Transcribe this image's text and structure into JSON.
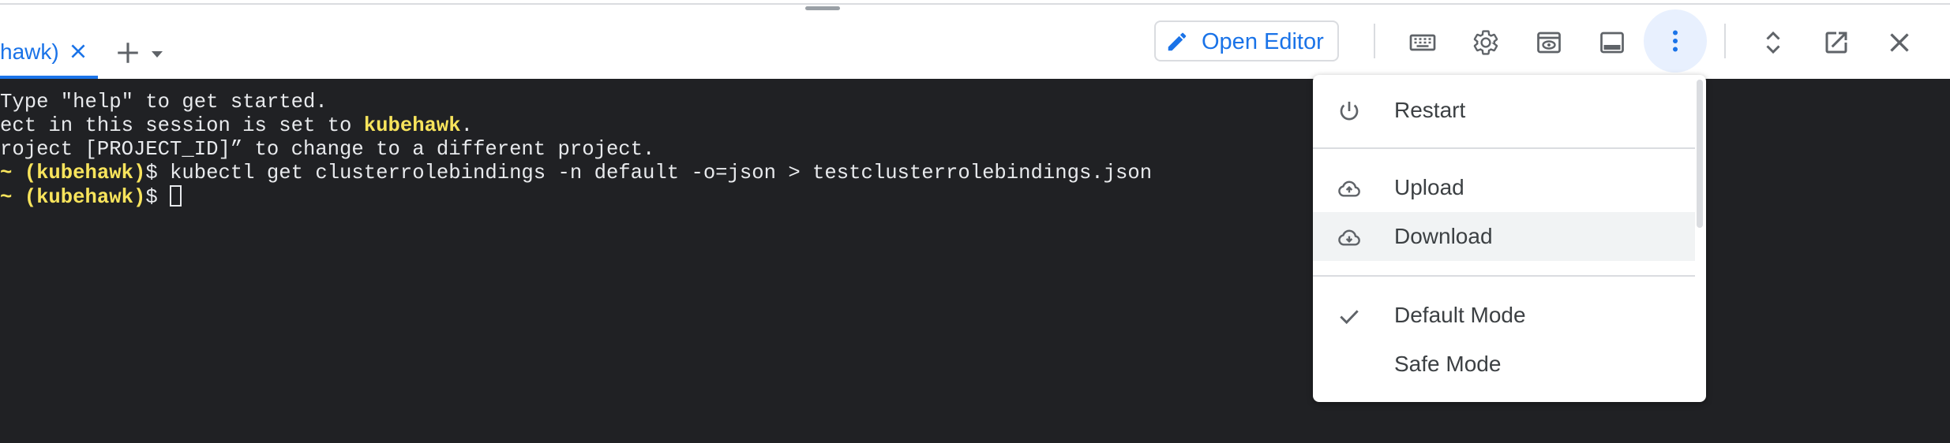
{
  "tab": {
    "label": "hawk)"
  },
  "toolbar": {
    "open_editor_label": "Open Editor"
  },
  "terminal": {
    "line1": "Type \"help\" to get started.",
    "line2_prefix": "ect in this session is set to ",
    "line2_project": "kubehawk",
    "line2_suffix": ".",
    "line3": "roject [PROJECT_ID]” to change to a different project.",
    "prompt_tilde": "~ ",
    "prompt_project": "(kubehawk)",
    "prompt_dollar": "$ ",
    "command1": "kubectl get clusterrolebindings -n default -o=json > testclusterrolebindings.json"
  },
  "menu": {
    "restart": "Restart",
    "upload": "Upload",
    "download": "Download",
    "default_mode": "Default Mode",
    "safe_mode": "Safe Mode"
  },
  "colors": {
    "accent": "#1a73e8",
    "terminal_bg": "#202124",
    "highlight_yellow": "#f8e45c"
  },
  "icons": [
    "close-icon",
    "plus-icon",
    "chevron-down-icon",
    "pencil-icon",
    "keyboard-icon",
    "gear-icon",
    "web-preview-icon",
    "panel-icon",
    "more-vert-icon",
    "unfold-icon",
    "open-new-window-icon",
    "close-icon",
    "power-icon",
    "cloud-upload-icon",
    "cloud-download-icon",
    "check-icon"
  ]
}
